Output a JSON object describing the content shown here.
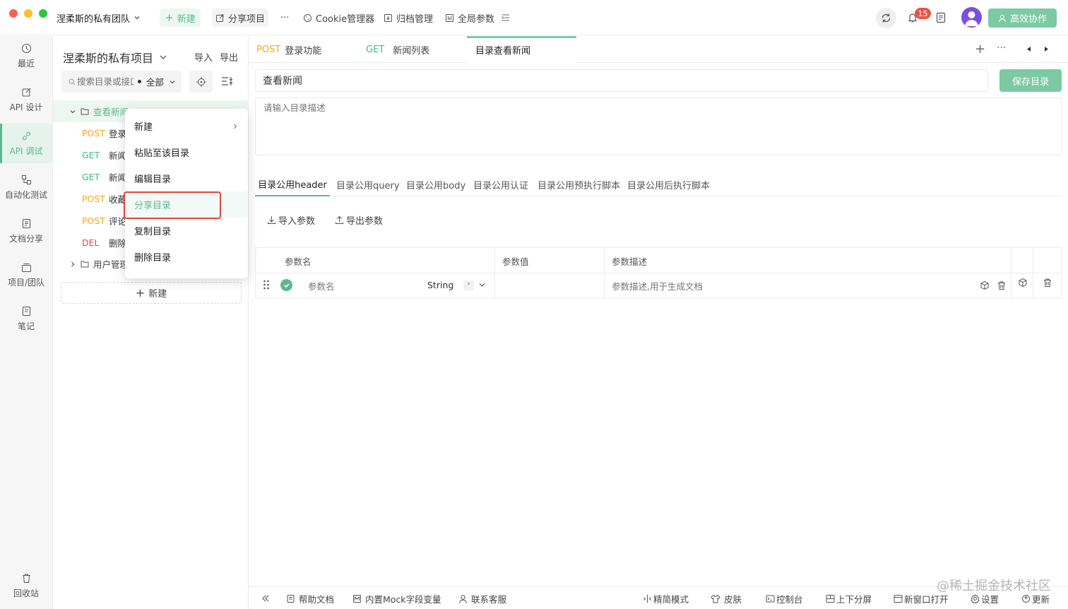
{
  "window": {
    "team_name": "涅柔斯的私有团队"
  },
  "topbar": {
    "new_label": "新建",
    "share_label": "分享项目",
    "more_label": "···",
    "cookie_label": "Cookie管理器",
    "archive_label": "归档管理",
    "global_params_label": "全局参数",
    "notification_count": "15",
    "collab_label": "高效协作"
  },
  "nav": {
    "recent": "最近",
    "api_design": "API 设计",
    "api_debug": "API 调试",
    "auto_test": "自动化测试",
    "doc_share": "文档分享",
    "project_team": "项目/团队",
    "notes": "笔记",
    "recycle": "回收站"
  },
  "project": {
    "title": "涅柔斯的私有项目",
    "import": "导入",
    "export": "导出",
    "search_placeholder": "搜索目录或接口",
    "filter_label": "全部",
    "folder_name": "查看新闻",
    "items": [
      {
        "method": "POST",
        "name": "登录功能"
      },
      {
        "method": "GET",
        "name": "新闻列表"
      },
      {
        "method": "GET",
        "name": "新闻详情"
      },
      {
        "method": "POST",
        "name": "收藏"
      },
      {
        "method": "POST",
        "name": "评论"
      },
      {
        "method": "DEL",
        "name": "删除"
      }
    ],
    "folder2_name": "用户管理",
    "new_button": "新建"
  },
  "context_menu": {
    "items": [
      "新建",
      "粘贴至该目录",
      "编辑目录",
      "分享目录",
      "复制目录",
      "删除目录"
    ]
  },
  "tabs": [
    {
      "method": "POST",
      "name": "登录功能"
    },
    {
      "method": "GET",
      "name": "新闻列表"
    },
    {
      "method": "",
      "name": "目录查看新闻"
    }
  ],
  "editor": {
    "folder_title": "查看新闻",
    "save_button": "保存目录",
    "desc_placeholder": "请输入目录描述",
    "subtabs": [
      "目录公用header",
      "目录公用query",
      "目录公用body",
      "目录公用认证",
      "目录公用预执行脚本",
      "目录公用后执行脚本"
    ],
    "import_params": "导入参数",
    "export_params": "导出参数",
    "table": {
      "headers": [
        "参数名",
        "参数值",
        "参数描述"
      ],
      "row": {
        "name_placeholder": "参数名",
        "type": "String",
        "desc_placeholder": "参数描述,用于生成文档"
      }
    }
  },
  "bottombar": {
    "help": "帮助文档",
    "mock": "内置Mock字段变量",
    "support": "联系客服",
    "simple_mode": "精简模式",
    "skin": "皮肤",
    "console": "控制台",
    "split": "上下分屏",
    "new_window": "新窗口打开",
    "settings": "设置",
    "update": "更新"
  },
  "watermark": "@稀土掘金技术社区",
  "colors": {
    "accent": "#5ab990",
    "post": "#f5a623",
    "get": "#3fbd7d",
    "del": "#e5484d",
    "highlight_box": "#e0473b"
  }
}
